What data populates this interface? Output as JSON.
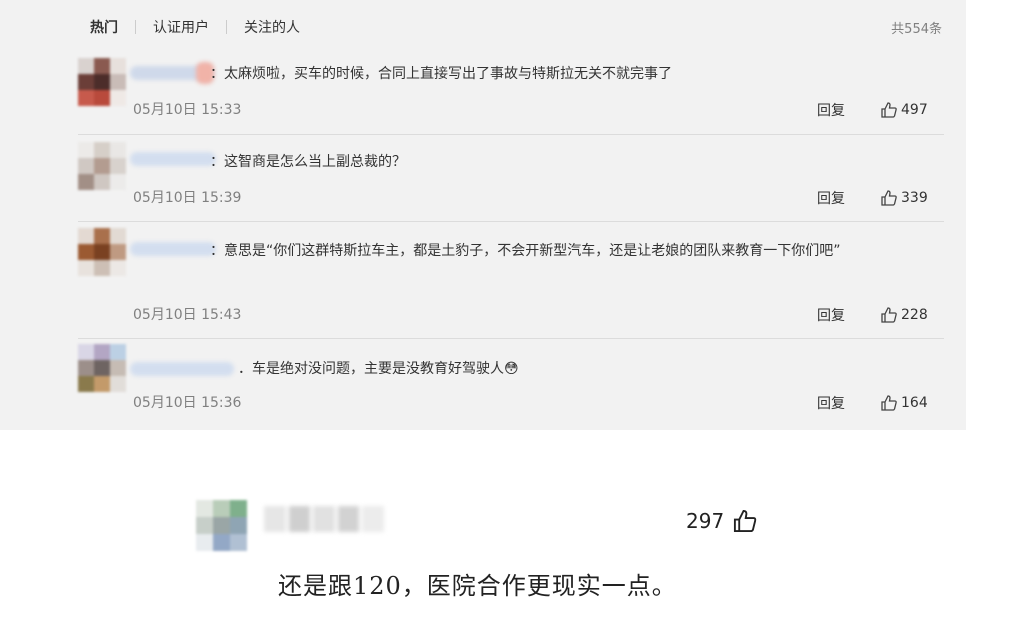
{
  "tabs": [
    "热门",
    "认证用户",
    "关注的人"
  ],
  "total": "共554条",
  "comments": [
    {
      "text": "：太麻烦啦，买车的时候，合同上直接写出了事故与特斯拉无关不就完事了",
      "time": "05月10日 15:33",
      "reply": "回复",
      "likes": "497"
    },
    {
      "text": "：这智商是怎么当上副总裁的？",
      "time": "05月10日 15:39",
      "reply": "回复",
      "likes": "339"
    },
    {
      "text": "：意思是“你们这群特斯拉车主，都是土豹子，不会开新型汽车，还是让老娘的团队来教育一下你们吧”",
      "time": "05月10日 15:43",
      "reply": "回复",
      "likes": "228"
    },
    {
      "text": "．车是绝对没问题，主要是没教育好驾驶人😳",
      "time": "05月10日 15:36",
      "reply": "回复",
      "likes": "164"
    }
  ],
  "card": {
    "likes": "297",
    "text": "还是跟120，医院合作更现实一点。"
  },
  "icons": {
    "like": "thumbs-up-icon"
  },
  "colors": {
    "panel": "#f2f2f2",
    "muted": "#808080"
  }
}
